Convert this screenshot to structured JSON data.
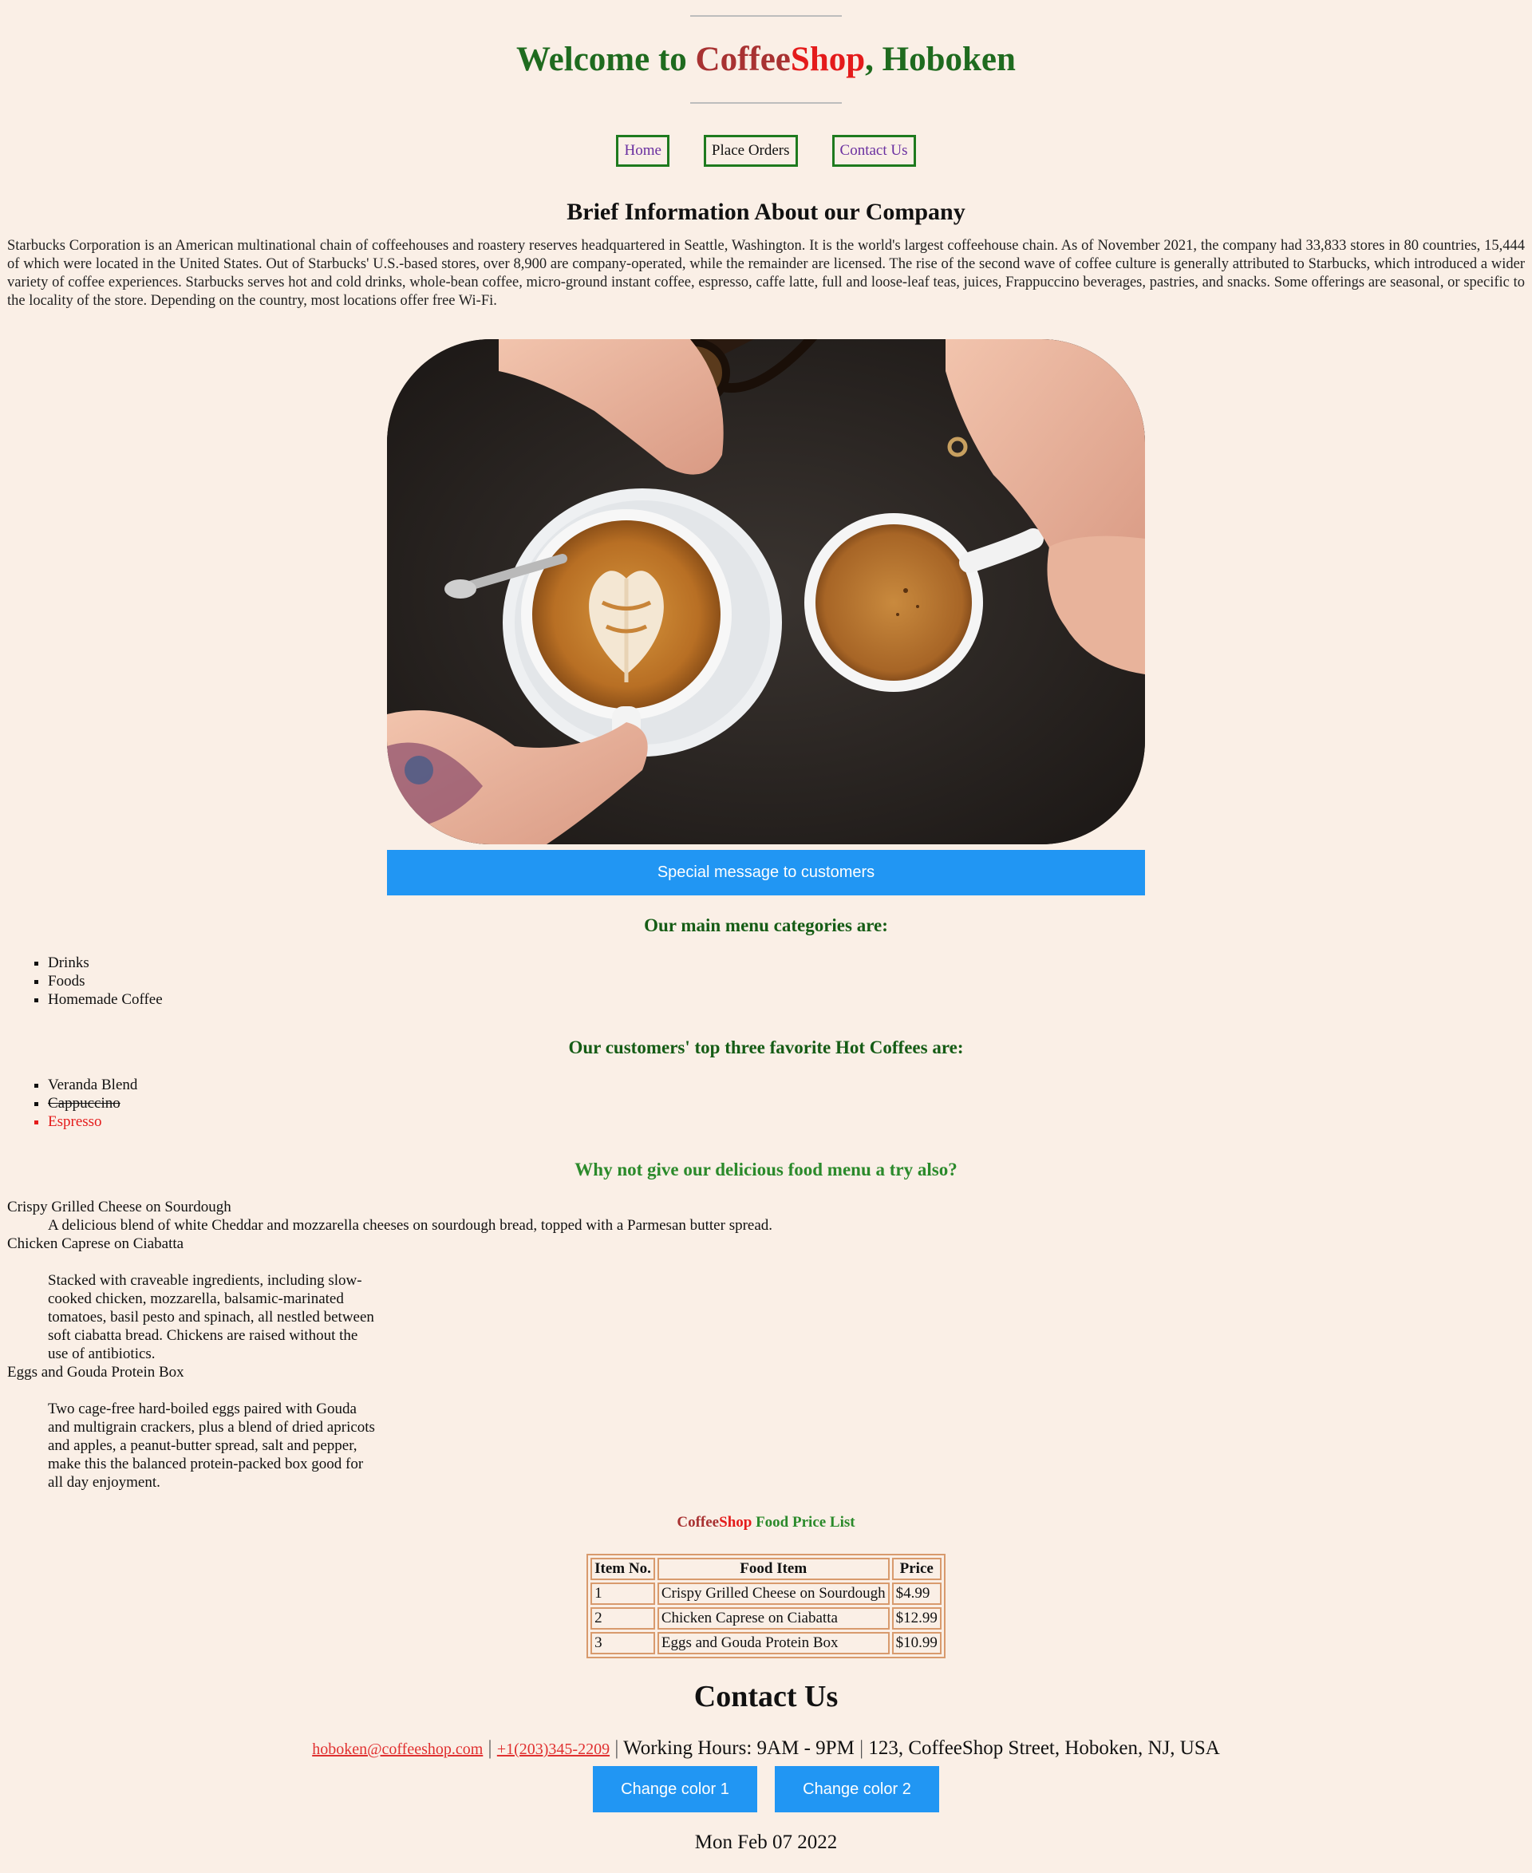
{
  "header": {
    "title_prefix": "Welcome to ",
    "title_coffee": "Coffee",
    "title_shop": "Shop",
    "title_suffix": ", Hoboken"
  },
  "nav": [
    {
      "label": "Home"
    },
    {
      "label": "Place Orders"
    },
    {
      "label": "Contact Us"
    }
  ],
  "about": {
    "heading": "Brief Information About our Company",
    "text": "Starbucks Corporation is an American multinational chain of coffeehouses and roastery reserves headquartered in Seattle, Washington. It is the world's largest coffeehouse chain. As of November 2021, the company had 33,833 stores in 80 countries, 15,444 of which were located in the United States. Out of Starbucks' U.S.-based stores, over 8,900 are company-operated, while the remainder are licensed. The rise of the second wave of coffee culture is generally attributed to Starbucks, which introduced a wider variety of coffee experiences. Starbucks serves hot and cold drinks, whole-bean coffee, micro-ground instant coffee, espresso, caffe latte, full and loose-leaf teas, juices, Frappuccino beverages, pastries, and snacks. Some offerings are seasonal, or specific to the locality of the store. Depending on the country, most locations offer free Wi-Fi."
  },
  "special_button": "Special message to customers",
  "menu": {
    "heading": "Our main menu categories are:",
    "items": [
      "Drinks",
      "Foods",
      "Homemade Coffee"
    ]
  },
  "favorites": {
    "heading": "Our customers' top three favorite Hot Coffees are:",
    "items": [
      "Veranda Blend",
      "Cappuccino",
      "Espresso"
    ]
  },
  "food": {
    "heading": "Why not give our delicious food menu a try also?",
    "items": [
      {
        "name": "Crispy Grilled Cheese on Sourdough",
        "desc": "A delicious blend of white Cheddar and mozzarella cheeses on sourdough bread, topped with a Parmesan butter spread."
      },
      {
        "name": "Chicken Caprese on Ciabatta",
        "desc": "Stacked with craveable ingredients, including slow-cooked chicken, mozzarella, balsamic-marinated tomatoes, basil pesto and spinach, all nestled between soft ciabatta bread. Chickens are raised without the use of antibiotics."
      },
      {
        "name": "Eggs and Gouda Protein Box",
        "desc": "Two cage-free hard-boiled eggs paired with Gouda and multigrain crackers, plus a blend of dried apricots and apples, a peanut-butter spread, salt and pepper, make this the balanced protein-packed box good for all day enjoyment."
      }
    ]
  },
  "price_list": {
    "title_coffee": "Coffee",
    "title_shop": "Shop",
    "title_rest": " Food Price List",
    "headers": [
      "Item No.",
      "Food Item",
      "Price"
    ],
    "rows": [
      [
        "1",
        "Crispy Grilled Cheese on Sourdough",
        "$4.99"
      ],
      [
        "2",
        "Chicken Caprese on Ciabatta",
        "$12.99"
      ],
      [
        "3",
        "Eggs and Gouda Protein Box",
        "$10.99"
      ]
    ]
  },
  "contact": {
    "heading": "Contact Us",
    "email": "hoboken@coffeeshop.com",
    "phone": "+1(203)345-2209",
    "hours": "Working Hours: 9AM - 9PM",
    "address": "123, CoffeeShop Street, Hoboken, NJ, USA",
    "separator": " | "
  },
  "color_buttons": [
    "Change color 1",
    "Change color 2"
  ],
  "date": "Mon Feb 07 2022",
  "colors": {
    "background": "#faefe6",
    "green": "#1f6b1f",
    "coffee_red": "#a83232",
    "shop_red": "#e41b1b",
    "button_blue": "#2196f3",
    "nav_border": "#1e7a1e",
    "table_border": "#d89a6d"
  }
}
